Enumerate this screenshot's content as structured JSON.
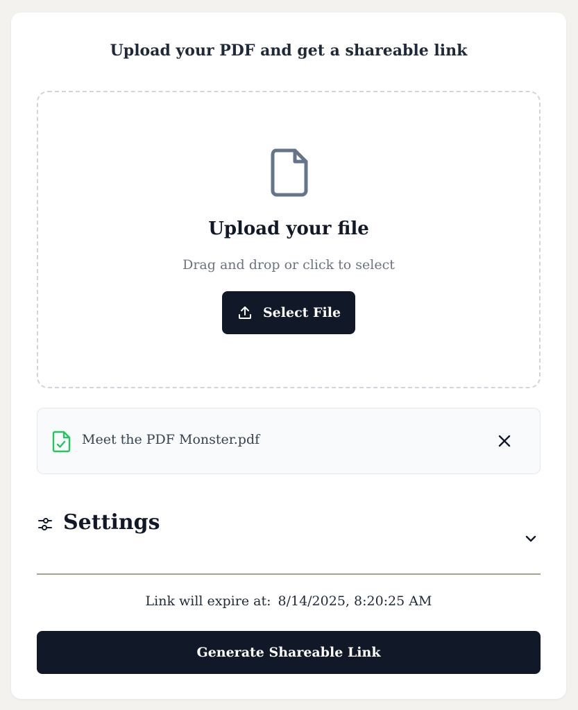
{
  "header": {
    "title": "Upload your PDF and get a shareable link"
  },
  "dropzone": {
    "title": "Upload your file",
    "subtitle": "Drag and drop or click to select",
    "select_button_label": "Select File",
    "icon": "file-icon"
  },
  "selected_file": {
    "name": "Meet the PDF Monster.pdf",
    "icon": "file-check-icon",
    "icon_color": "#22c55e",
    "remove_icon": "close-icon"
  },
  "settings": {
    "label": "Settings",
    "icon": "sliders-icon",
    "expand_icon": "chevron-down-icon"
  },
  "expiry": {
    "label": "Link will expire at:",
    "value": "8/14/2025, 8:20:25 AM"
  },
  "actions": {
    "generate_label": "Generate Shareable Link"
  },
  "colors": {
    "primary": "#111827",
    "accent_success": "#22c55e",
    "muted": "#6b7280"
  }
}
